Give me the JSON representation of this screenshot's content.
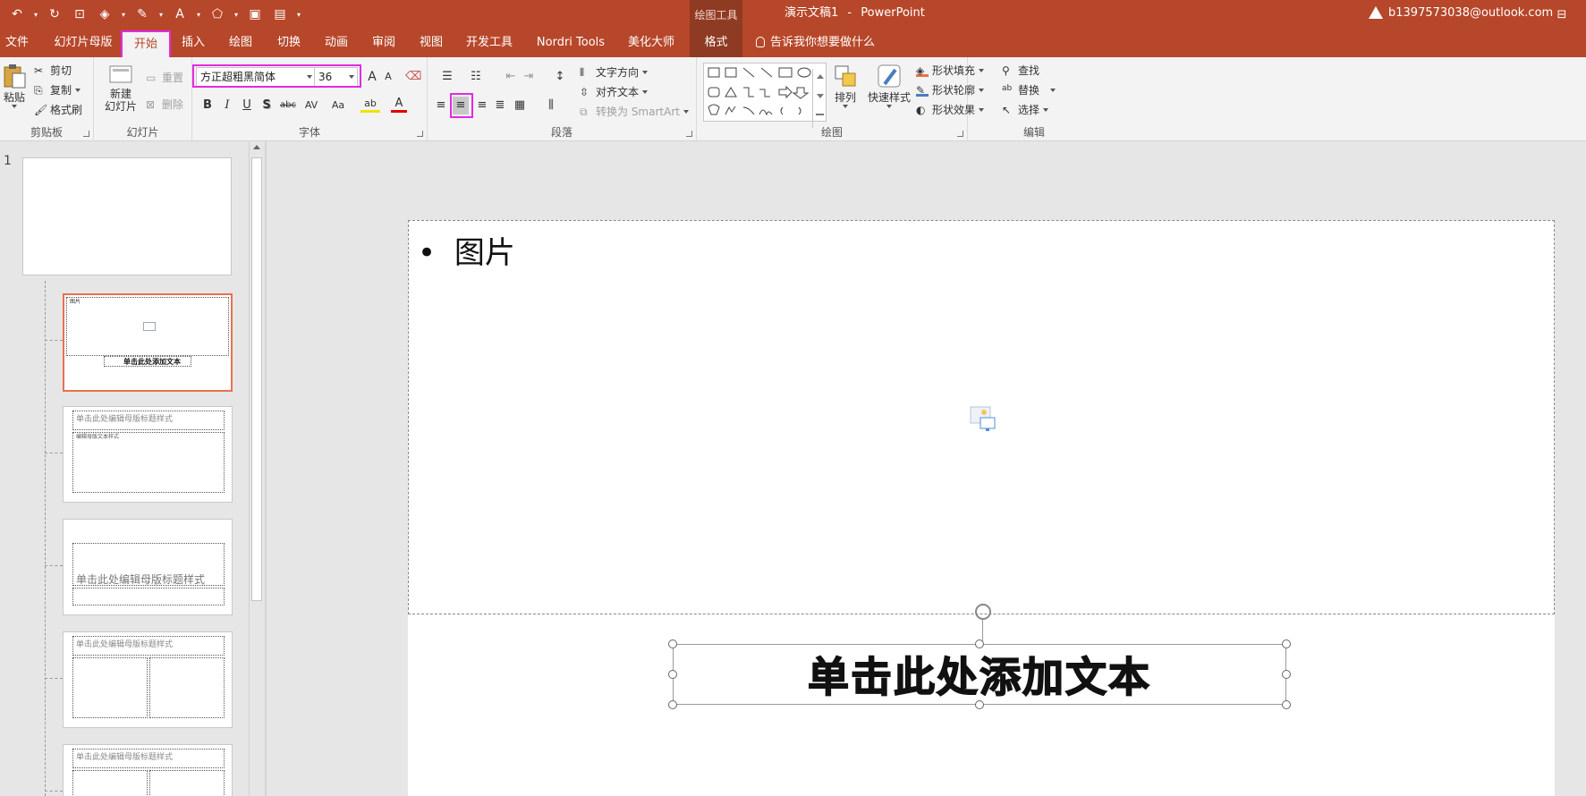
{
  "colors": {
    "accent": "#b7472a",
    "context": "#8f3a22",
    "highlight": "#e22be2",
    "selected_thumb": "#e8714e"
  },
  "titlebar": {
    "context_tools": "绘图工具",
    "doc_name": "演示文稿1",
    "separator": "-",
    "app_name": "PowerPoint",
    "account": "b1397573038@outlook.com"
  },
  "tabs": [
    {
      "label": "文件"
    },
    {
      "label": "幻灯片母版"
    },
    {
      "label": "开始"
    },
    {
      "label": "插入"
    },
    {
      "label": "绘图"
    },
    {
      "label": "切换"
    },
    {
      "label": "动画"
    },
    {
      "label": "审阅"
    },
    {
      "label": "视图"
    },
    {
      "label": "开发工具"
    },
    {
      "label": "Nordri Tools"
    },
    {
      "label": "美化大师"
    },
    {
      "label": "格式"
    }
  ],
  "tell_me": "告诉我你想要做什么",
  "ribbon": {
    "clipboard": {
      "label": "剪贴板",
      "paste": "粘贴",
      "cut": "剪切",
      "copy": "复制",
      "format_painter": "格式刷"
    },
    "slides": {
      "label": "幻灯片",
      "new_slide_1": "新建",
      "new_slide_2": "幻灯片",
      "reset": "重置",
      "delete": "删除"
    },
    "font": {
      "label": "字体",
      "font_name": "方正超粗黑简体",
      "font_size": "36",
      "bold": "B",
      "italic": "I",
      "underline": "U",
      "shadow": "S",
      "strike": "abc",
      "spacing": "AV",
      "case": "Aa",
      "grow": "A",
      "shrink": "A",
      "highlight": "ab",
      "color": "A"
    },
    "paragraph": {
      "label": "段落",
      "text_direction": "文字方向",
      "align_text": "对齐文本",
      "smartart": "转换为 SmartArt"
    },
    "drawing": {
      "label": "绘图",
      "arrange": "排列",
      "quick_styles": "快速样式",
      "shape_fill": "形状填充",
      "shape_outline": "形状轮廓",
      "shape_effects": "形状效果"
    },
    "editing": {
      "label": "编辑",
      "find": "查找",
      "replace": "替换",
      "select": "选择"
    }
  },
  "thumbnails": {
    "slide_number": "1",
    "sel_title": "图片",
    "sel_text": "单击此处添加文本",
    "master_title": "单击此处编辑母版标题样式",
    "master_text": "编辑母版文本样式"
  },
  "slide": {
    "bullet": "•",
    "picture_placeholder": "图片",
    "textbox": "单击此处添加文本"
  }
}
